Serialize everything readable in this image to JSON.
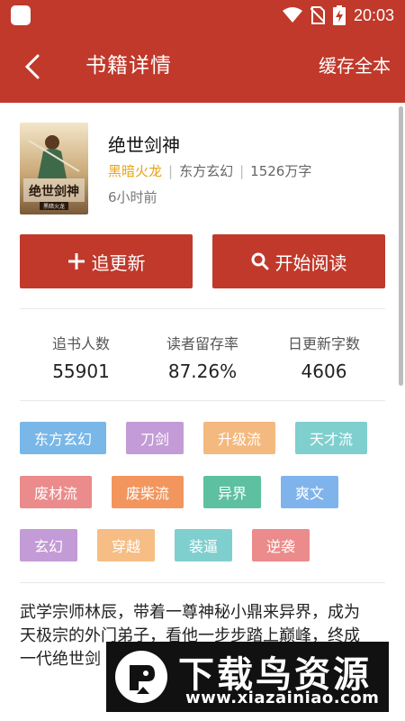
{
  "status_bar": {
    "time": "20:03"
  },
  "app_bar": {
    "title": "书籍详情",
    "cache_label": "缓存全本"
  },
  "book": {
    "title": "绝世剑神",
    "author": "黑暗火龙",
    "category": "东方玄幻",
    "word_count": "1526万字",
    "updated": "6小时前",
    "cover_text": "绝世剑神",
    "cover_author": "黑暗火龙"
  },
  "actions": {
    "follow_label": "追更新",
    "read_label": "开始阅读"
  },
  "stats": [
    {
      "label": "追书人数",
      "value": "55901"
    },
    {
      "label": "读者留存率",
      "value": "87.26%"
    },
    {
      "label": "日更新字数",
      "value": "4606"
    }
  ],
  "tags": [
    {
      "label": "东方玄幻",
      "color": "#79b7e8"
    },
    {
      "label": "刀剑",
      "color": "#c39bd6"
    },
    {
      "label": "升级流",
      "color": "#f4b97e"
    },
    {
      "label": "天才流",
      "color": "#7fcfce"
    },
    {
      "label": "废材流",
      "color": "#eb8b8b"
    },
    {
      "label": "废柴流",
      "color": "#f2965e"
    },
    {
      "label": "异界",
      "color": "#5dc0a0"
    },
    {
      "label": "爽文",
      "color": "#7fb3ec"
    },
    {
      "label": "玄幻",
      "color": "#c39bd6"
    },
    {
      "label": "穿越",
      "color": "#f6bd84"
    },
    {
      "label": "装逼",
      "color": "#7fcfce"
    },
    {
      "label": "逆袭",
      "color": "#eb8b8b"
    }
  ],
  "description": {
    "line1": "武学宗师林辰，带着一尊神秘小鼎来异界，成为",
    "line2": "天极宗的外门弟子，看他一步步踏上巅峰，终成",
    "line3": "一代绝世剑"
  },
  "watermark": {
    "title": "下载鸟资源",
    "url": "www.xiazainiao.com"
  },
  "colors": {
    "primary": "#c0392b",
    "author": "#e6a317"
  }
}
